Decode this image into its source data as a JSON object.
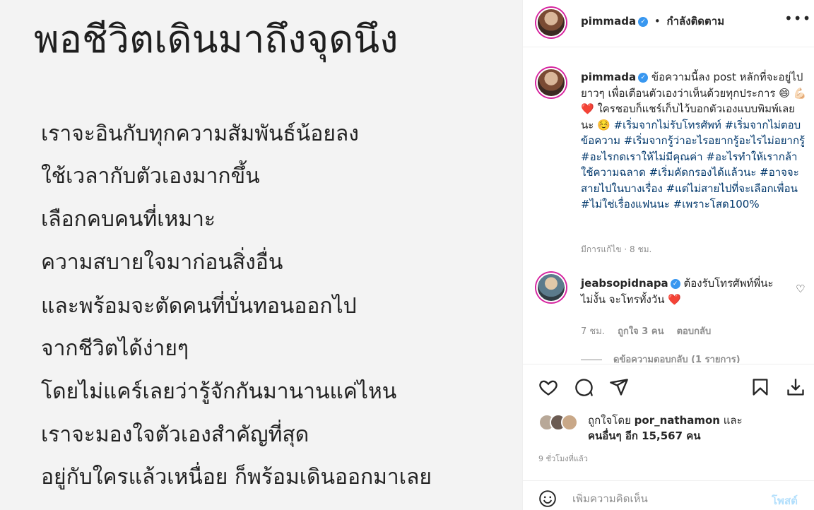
{
  "image": {
    "title": "พอชีวิตเดินมาถึงจุดนึง",
    "lines": [
      "เราจะอินกับทุกความสัมพันธ์น้อยลง",
      " ใช้เวลากับตัวเองมากขึ้น",
      "เลือกคบคนที่เหมาะ",
      " ความสบายใจมาก่อนสิ่งอื่น",
      "และพร้อมจะตัดคนที่บั่นทอนออกไป",
      "จากชีวิตได้ง่ายๆ",
      "โดยไม่แคร์เลยว่ารู้จักกันมานานแค่ไหน",
      "เราจะมองใจตัวเองสำคัญที่สุด",
      "อยู่กับใครแล้วเหนื่อย ก็พร้อมเดินออกมาเลย"
    ]
  },
  "header": {
    "username": "pimmada",
    "separator": "•",
    "follow_status": "กำลังติดตาม",
    "more": "•••"
  },
  "caption": {
    "username": "pimmada",
    "text": "ข้อความนี้ลง post หลักที่จะอยู่ไปยาวๆ เพื่อเตือนตัวเองว่าเห็นด้วยทุกประการ 😄 💪🏻 ❤️ ใครชอบก็แชร์เก็บไว้บอกตัวเองแบบพิมพ์เลยนะ ☺️ ",
    "hashtags": "#เริ่มจากไม่รับโทรศัพท์ #เริ่มจากไม่ตอบข้อความ #เริ่มจากรู้ว่าอะไรอยากรู้อะไรไม่อยากรู้ #อะไรกดเราให้ไม่มีคุณค่า #อะไรทำให้เรากล้าใช้ความฉลาด #เริ่มคัดกรองได้แล้วนะ #อาจจะสายไปในบางเรื่อง #แต่ไม่สายไปที่จะเลือกเพื่อน #ไม่ใช่เรื่องแฟนนะ #เพราะโสด100%",
    "edited": "มีการแก้ไข · 8 ชม."
  },
  "reply": {
    "username": "jeabsopidnapa",
    "text": "ต้องรับโทรศัพท์พี่นะ ไม่งั้น จะโทรทั้งวัน ❤️",
    "time": "7 ชม.",
    "likes": "ถูกใจ 3 คน",
    "reply_label": "ตอบกลับ",
    "view_replies": "ดูข้อความตอบกลับ (1 รายการ)"
  },
  "likes": {
    "prefix": "ถูกใจโดย",
    "user": "por_nathamon",
    "and": "และ",
    "others": "คนอื่นๆ อีก 15,567 คน"
  },
  "time_ago": "9 ชั่วโมงที่แล้ว",
  "comment_box": {
    "placeholder": "เพิ่มความคิดเห็น",
    "post_label": "โพสต์"
  },
  "colors": {
    "link": "#00376b",
    "verified": "#3897f0",
    "heart": "#ed4956",
    "post_disabled": "#b2dffc"
  },
  "icons": [
    "heart-icon",
    "comment-icon",
    "share-icon",
    "bookmark-icon",
    "download-icon",
    "emoji-icon",
    "verified-icon",
    "more-icon"
  ]
}
